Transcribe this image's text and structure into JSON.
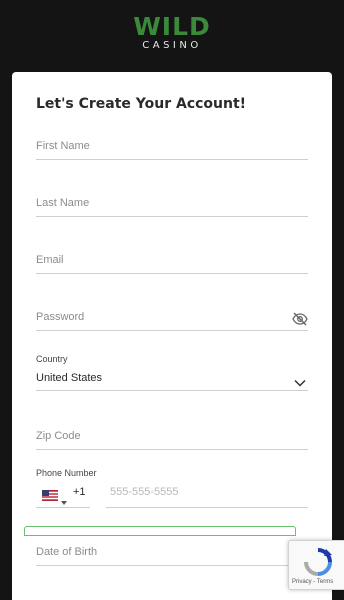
{
  "brand": {
    "logo_top": "WILD",
    "logo_bottom": "CASINO",
    "accent_color": "#3a8a3a"
  },
  "form": {
    "title": "Let's Create Your Account!",
    "first_name": {
      "placeholder": "First Name",
      "value": ""
    },
    "last_name": {
      "placeholder": "Last Name",
      "value": ""
    },
    "email": {
      "placeholder": "Email",
      "value": ""
    },
    "password": {
      "placeholder": "Password",
      "value": "",
      "icon": "eye-off-icon"
    },
    "country": {
      "label": "Country",
      "value": "United States",
      "icon": "chevron-down-icon"
    },
    "zip": {
      "placeholder": "Zip Code",
      "value": ""
    },
    "phone": {
      "label": "Phone Number",
      "flag": "us-flag-icon",
      "code": "+1",
      "placeholder": "555-555-5555"
    },
    "dob": {
      "placeholder": "Date of Birth",
      "value": ""
    }
  },
  "recaptcha": {
    "links": "Privacy - Terms"
  }
}
